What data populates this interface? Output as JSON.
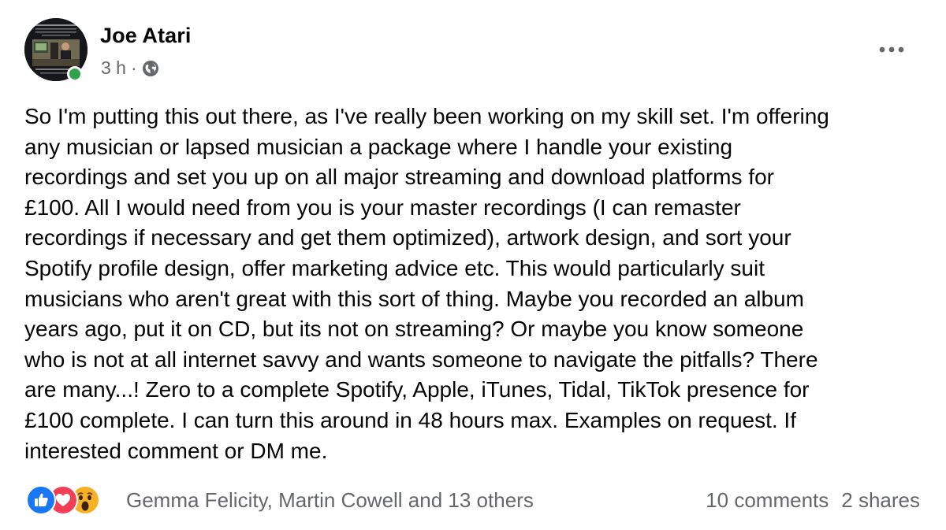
{
  "post": {
    "author": "Joe Atari",
    "time": "3 h",
    "separator": "·",
    "privacy_icon": "globe-icon",
    "more_icon": "more-horizontal-icon",
    "body": "So I'm putting this out there, as I've really been working on my skill set. I'm offering\nany musician or lapsed musician a package where I handle your existing\nrecordings and set you up on all major streaming and download platforms for\n£100. All I would need from you is your master recordings (I can remaster\nrecordings if necessary and get them optimized), artwork design, and sort your\nSpotify profile design, offer marketing advice etc. This would particularly suit\nmusicians who aren't great with this sort of thing. Maybe you recorded an album\nyears ago, put it on CD, but its not on streaming? Or maybe you know someone\nwho is not at all internet savvy and wants someone to navigate the pitfalls? There\nare many...! Zero to a complete Spotify, Apple, iTunes, Tidal, TikTok presence for\n£100 complete. I can turn this around in 48 hours max. Examples on request.  If\ninterested comment or DM me."
  },
  "reactions": {
    "icons": [
      "like-icon",
      "love-icon",
      "wow-icon"
    ],
    "summary": "Gemma Felicity, Martin Cowell and 13 others",
    "comments": "10 comments",
    "shares": "2 shares"
  },
  "colors": {
    "text": "#050505",
    "secondary_text": "#65676b",
    "online": "#31a24c",
    "like": "#1877f2",
    "love": "#f33e58",
    "wow": "#f7b125"
  }
}
